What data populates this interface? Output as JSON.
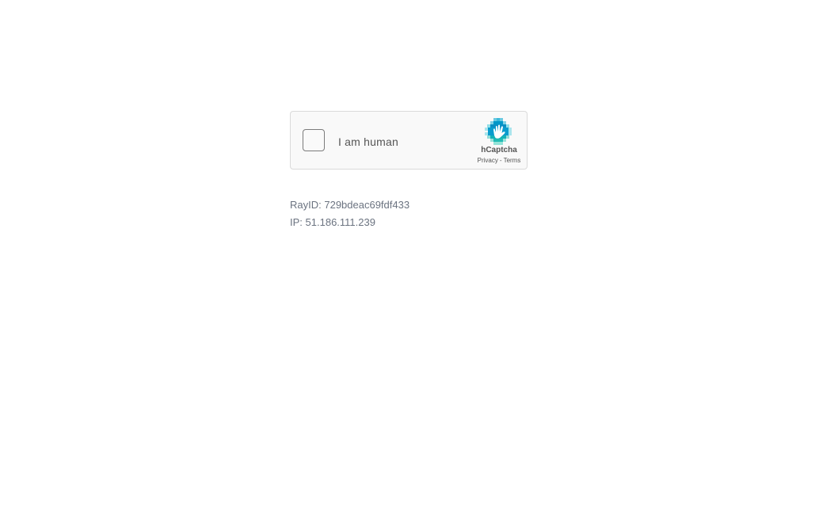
{
  "captcha": {
    "checkbox_label": "I am human",
    "brand_name": "hCaptcha",
    "privacy_link": "Privacy",
    "separator": "-",
    "terms_link": "Terms",
    "logo_icon": "hcaptcha-hand-logo",
    "colors": {
      "widget_bg": "#f9f9f9",
      "widget_border": "#dadada",
      "logo_teal": "#0074bf",
      "logo_cyan": "#00bcd4"
    }
  },
  "info": {
    "ray_label": "RayID:",
    "ray_value": "729bdeac69fdf433",
    "ip_label": "IP:",
    "ip_value": "51.186.111.239"
  }
}
